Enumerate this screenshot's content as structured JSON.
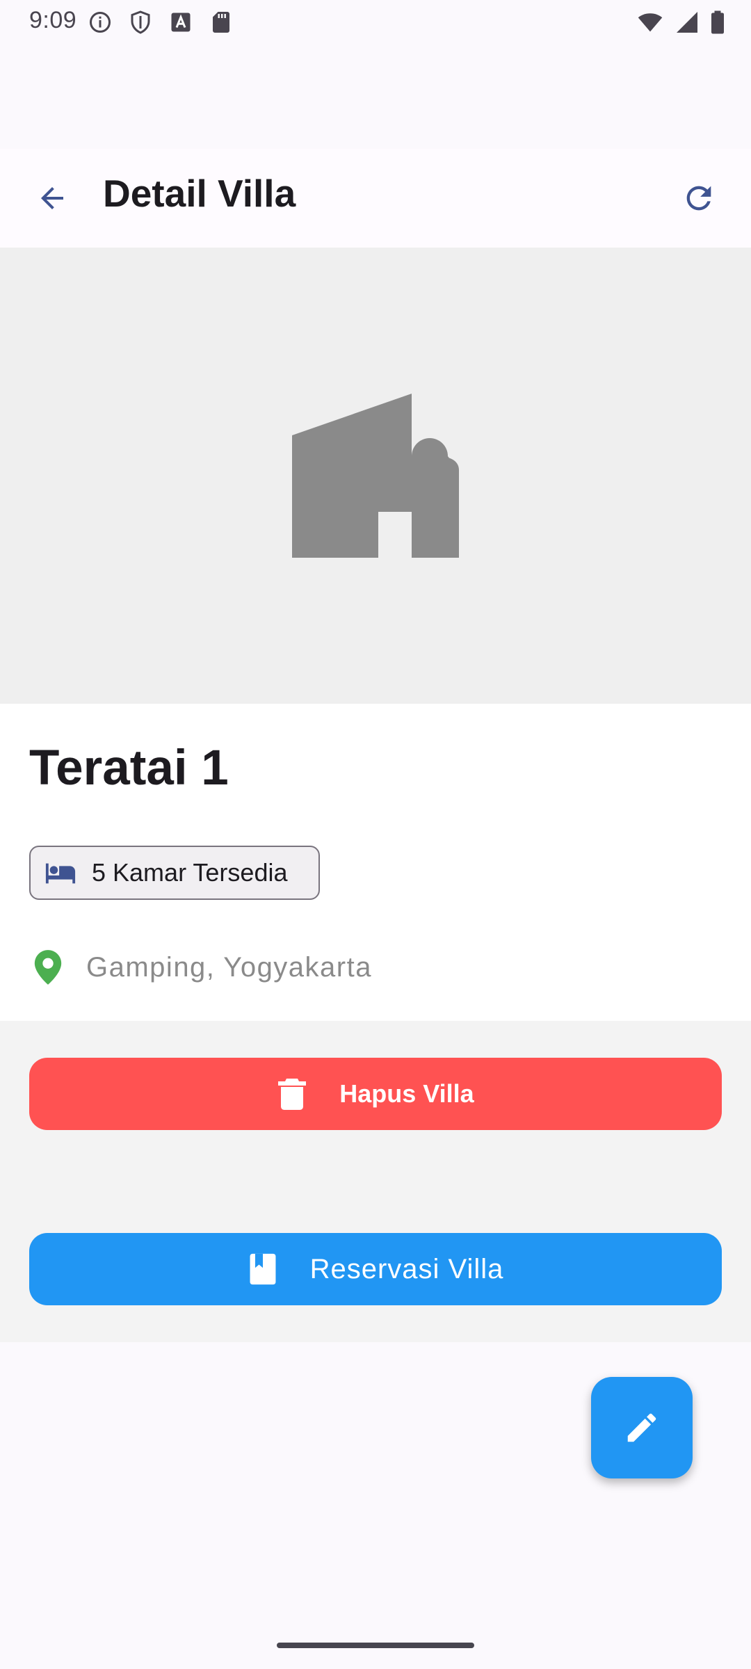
{
  "status_bar": {
    "time": "9:09",
    "left_icons": [
      "info-icon",
      "shield-icon",
      "font-icon",
      "sd-card-icon"
    ],
    "right_icons": [
      "wifi-icon",
      "signal-icon",
      "battery-icon"
    ]
  },
  "app_bar": {
    "title": "Detail Villa",
    "back_icon": "arrow-back-icon",
    "refresh_icon": "refresh-icon"
  },
  "hero": {
    "placeholder_icon": "house-icon"
  },
  "villa": {
    "name": "Teratai 1",
    "rooms_label": "5 Kamar Tersedia",
    "location": "Gamping, Yogyakarta"
  },
  "actions": {
    "delete_label": "Hapus Villa",
    "reserve_label": "Reservasi Villa"
  },
  "colors": {
    "accent_blue": "#2196f3",
    "danger_red": "#ff5252",
    "location_green": "#4caf50",
    "icon_blue": "#3f5391"
  }
}
